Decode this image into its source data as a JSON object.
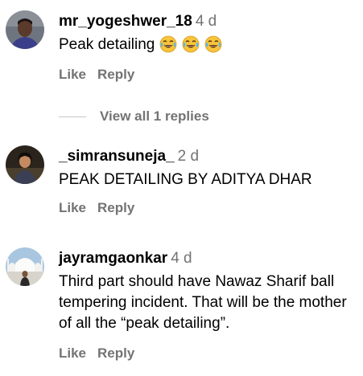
{
  "comments": [
    {
      "username": "mr_yogeshwer_18",
      "time": "4 d",
      "text": "Peak detailing",
      "emojis": [
        "face-with-tears-of-joy-icon",
        "face-with-tears-of-joy-icon",
        "face-with-tears-of-joy-icon"
      ],
      "like_label": "Like",
      "reply_label": "Reply"
    },
    {
      "username": "_simransuneja_",
      "time": "2 d",
      "text": "PEAK DETAILING BY ADITYA DHAR",
      "like_label": "Like",
      "reply_label": "Reply"
    },
    {
      "username": "jayramgaonkar",
      "time": "4 d",
      "text": "Third part should have Nawaz Sharif ball tempering incident. That will be the mother of all the “peak detailing”.",
      "like_label": "Like",
      "reply_label": "Reply"
    }
  ],
  "view_replies_label": "View all 1 replies",
  "colors": {
    "text": "#000000",
    "secondary": "#737373",
    "divider": "#c7c7c7"
  }
}
